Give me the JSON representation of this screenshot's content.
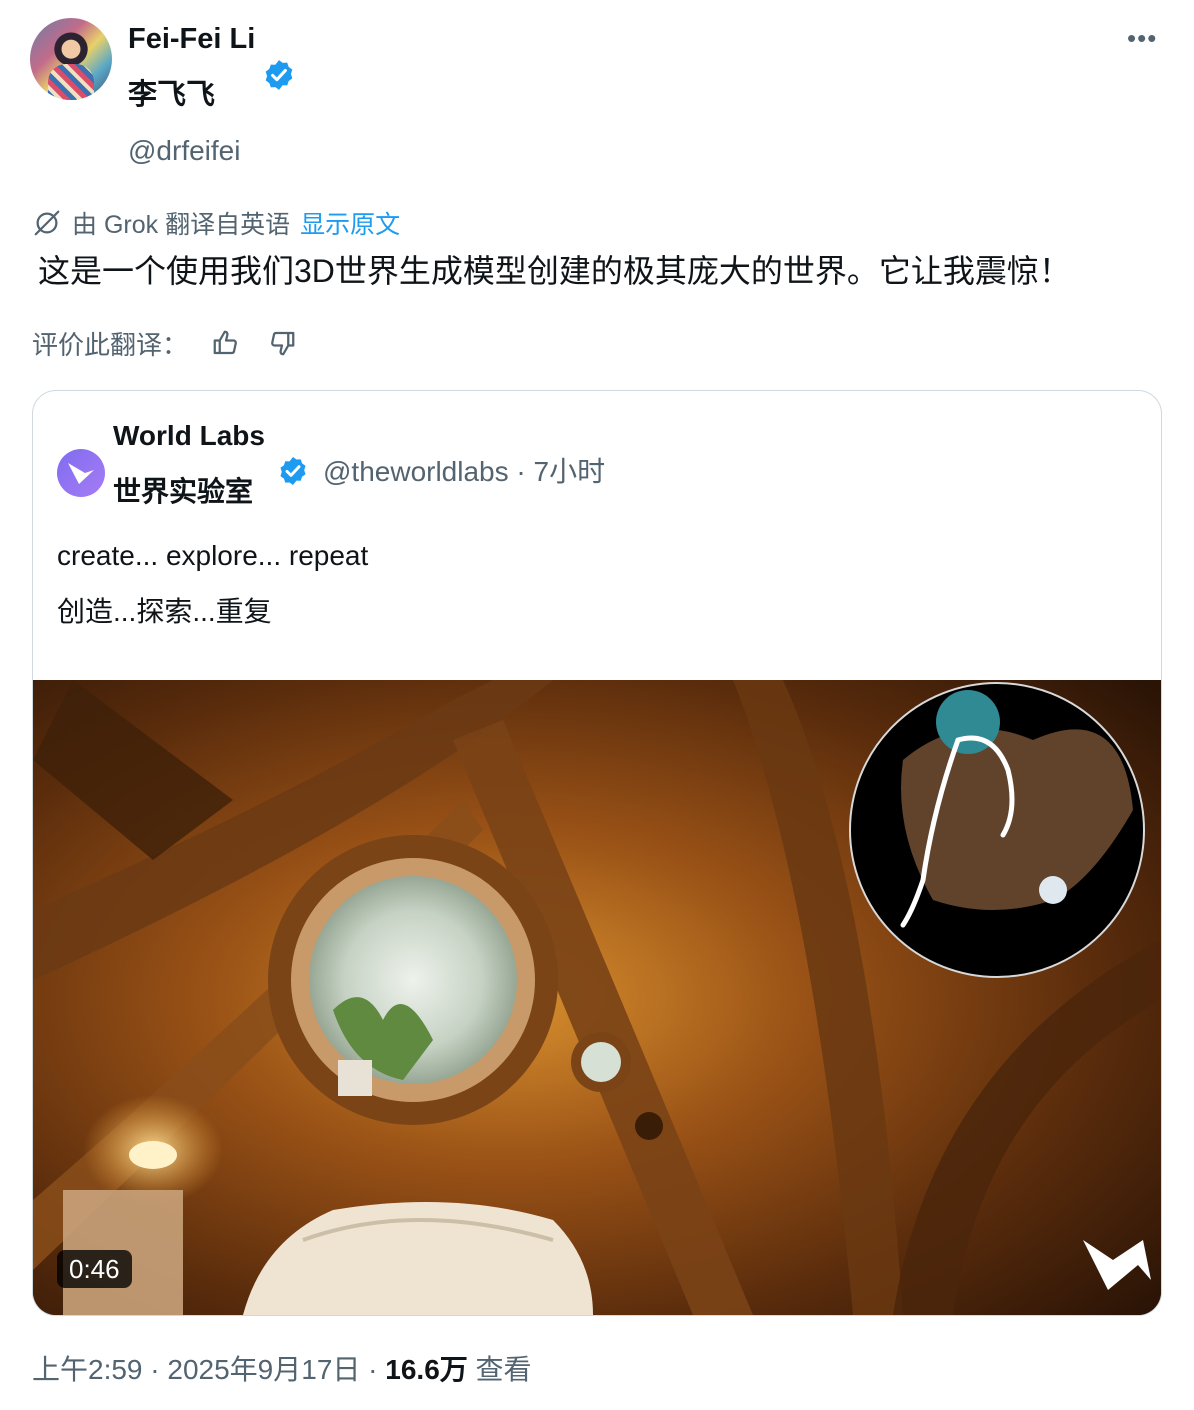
{
  "author": {
    "name": "Fei-Fei Li",
    "name_cn": "李飞飞",
    "handle": "@drfeifei",
    "verified_icon": "verified-badge-icon"
  },
  "menu": {
    "more_label": "•••"
  },
  "translation": {
    "label": "由 Grok 翻译自英语",
    "show_original": "显示原文"
  },
  "tweet": {
    "text": "这是一个使用我们3D世界生成模型创建的极其庞大的世界。它让我震惊！"
  },
  "rating": {
    "label": "评价此翻译：",
    "thumb_up_icon": "thumbs-up-icon",
    "thumb_down_icon": "thumbs-down-icon"
  },
  "quote": {
    "name": "World Labs",
    "name_cn": "世界实验室",
    "meta": "@theworldlabs · 7小时",
    "text_en": "create... explore... repeat",
    "text_cn": "创造...探索...重复",
    "video_duration": "0:46"
  },
  "footer": {
    "timestamp": "上午2:59 · 2025年9月17日 · ",
    "views_count": "16.6万",
    "views_label": " 查看"
  },
  "colors": {
    "accent": "#1d9bf0",
    "secondary_text": "#536471",
    "border": "#cfd9de"
  }
}
